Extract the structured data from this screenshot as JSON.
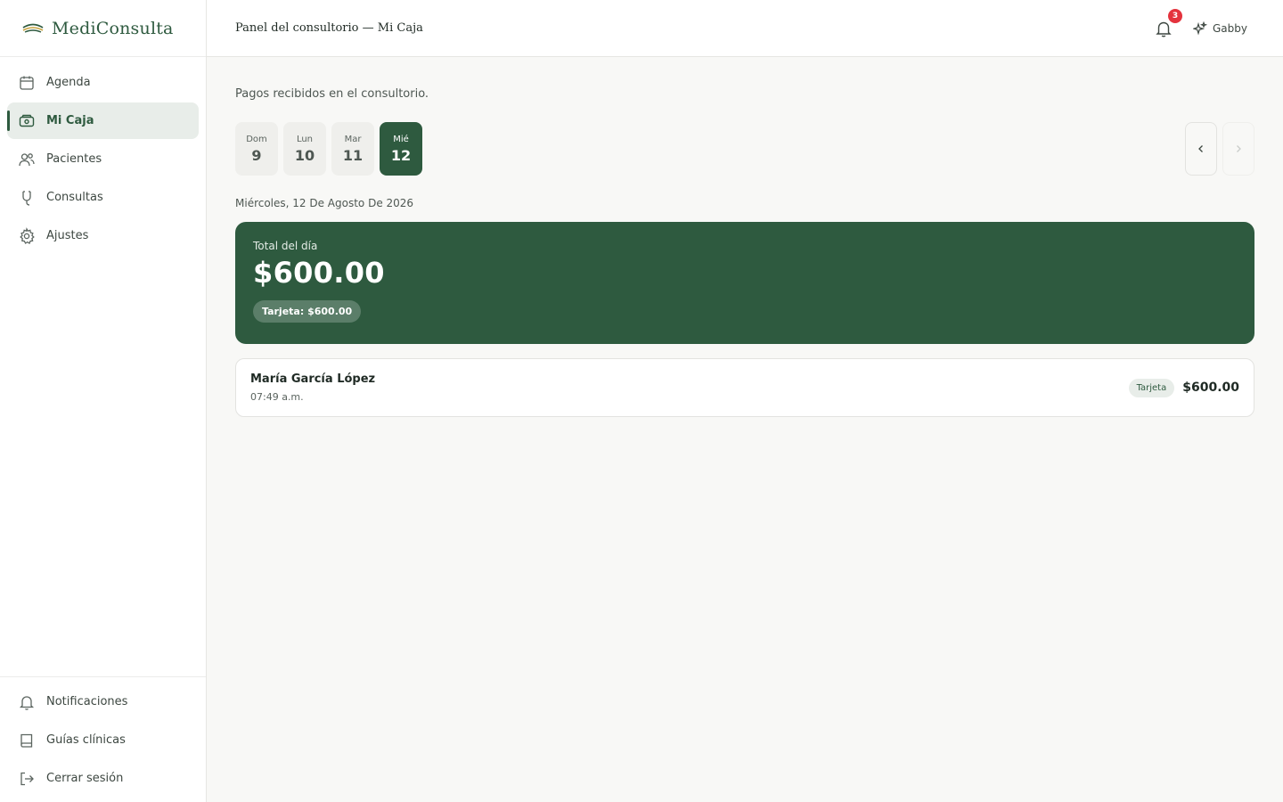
{
  "brand": {
    "name": "MediConsulta"
  },
  "sidebar": {
    "items": [
      {
        "label": "Agenda",
        "icon": "calendar-icon",
        "active": false
      },
      {
        "label": "Mi Caja",
        "icon": "wallet-icon",
        "active": true
      },
      {
        "label": "Pacientes",
        "icon": "users-icon",
        "active": false
      },
      {
        "label": "Consultas",
        "icon": "stethoscope-icon",
        "active": false
      },
      {
        "label": "Ajustes",
        "icon": "gear-icon",
        "active": false
      }
    ],
    "bottom_items": [
      {
        "label": "Notificaciones",
        "icon": "bell-icon"
      },
      {
        "label": "Guías clínicas",
        "icon": "book-icon"
      },
      {
        "label": "Cerrar sesión",
        "icon": "logout-icon"
      }
    ]
  },
  "header": {
    "title": "Panel del consultorio — Mi Caja",
    "notifications_count": "3",
    "user_name": "Gabby"
  },
  "main": {
    "subtitle": "Pagos recibidos en el consultorio.",
    "days": [
      {
        "name": "Dom",
        "number": "9",
        "selected": false
      },
      {
        "name": "Lun",
        "number": "10",
        "selected": false
      },
      {
        "name": "Mar",
        "number": "11",
        "selected": false
      },
      {
        "name": "Mié",
        "number": "12",
        "selected": true
      }
    ],
    "selected_date": "Miércoles, 12 De Agosto De 2026",
    "total": {
      "label": "Total del día",
      "value": "$600.00",
      "breakdown": "Tarjeta: $600.00"
    },
    "payments": [
      {
        "patient": "María García López",
        "time": "07:49 a.m.",
        "method": "Tarjeta",
        "amount": "$600.00"
      }
    ]
  },
  "colors": {
    "accent": "#2e5a3f",
    "badge": "#e4333d"
  }
}
